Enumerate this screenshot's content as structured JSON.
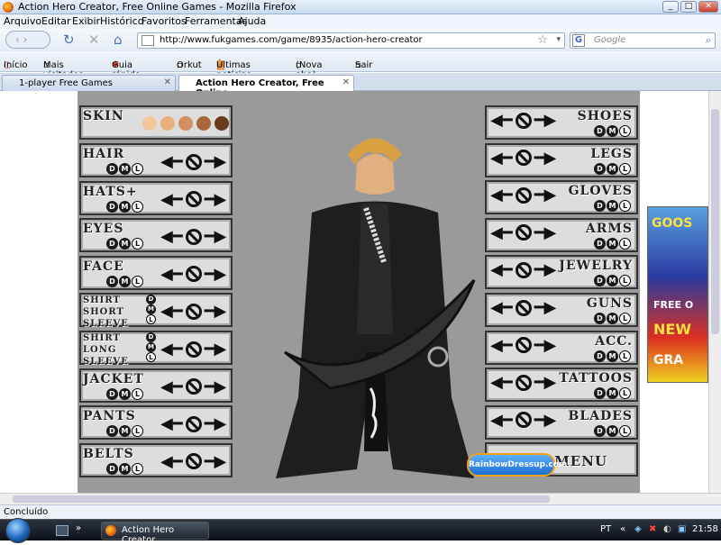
{
  "window": {
    "title": "Action Hero Creator, Free Online Games - Mozilla Firefox"
  },
  "menu": [
    "Arquivo",
    "Editar",
    "Exibir",
    "Histórico",
    "Favoritos",
    "Ferramentas",
    "Ajuda"
  ],
  "url": "http://www.fukgames.com/game/8935/action-hero-creator",
  "search_placeholder": "Google",
  "bookmarks": [
    "Início",
    "Mais visitados",
    "Guia rápido",
    "Orkut",
    "Últimas notícias",
    "(Nova aba)",
    "Sair"
  ],
  "tabs": [
    {
      "label": "1-player Free Games"
    },
    {
      "label": "Action Hero Creator, Free Online ..."
    }
  ],
  "game": {
    "skin_label": "SKIN",
    "skin_colors": [
      "#f4c79a",
      "#e8b07a",
      "#d29060",
      "#a8683c",
      "#6a3c1c"
    ],
    "left_items": [
      {
        "label": "HAIR"
      },
      {
        "label": "HATS+"
      },
      {
        "label": "EYES"
      },
      {
        "label": "FACE"
      },
      {
        "label": "SHIRT SHORT SLEEVE"
      },
      {
        "label": "SHIRT LONG SLEEVE"
      },
      {
        "label": "JACKET"
      },
      {
        "label": "PANTS"
      },
      {
        "label": "BELTS"
      }
    ],
    "right_items": [
      {
        "label": "SHOES"
      },
      {
        "label": "LEGS"
      },
      {
        "label": "GLOVES"
      },
      {
        "label": "ARMS"
      },
      {
        "label": "JEWELRY"
      },
      {
        "label": "GUNS"
      },
      {
        "label": "ACC."
      },
      {
        "label": "TATTOOS"
      },
      {
        "label": "BLADES"
      }
    ],
    "main_menu": "MAIN MENU",
    "dml": [
      "D",
      "M",
      "L"
    ],
    "logo": "RainbowDressup.com"
  },
  "ad": {
    "brand": "GOOS",
    "line1": "FREE O",
    "line2": "NEW",
    "line3": "GRA"
  },
  "status": "Concluído",
  "taskbar": {
    "item": "Action Hero Creator...",
    "lang": "PT",
    "time": "21:58"
  }
}
